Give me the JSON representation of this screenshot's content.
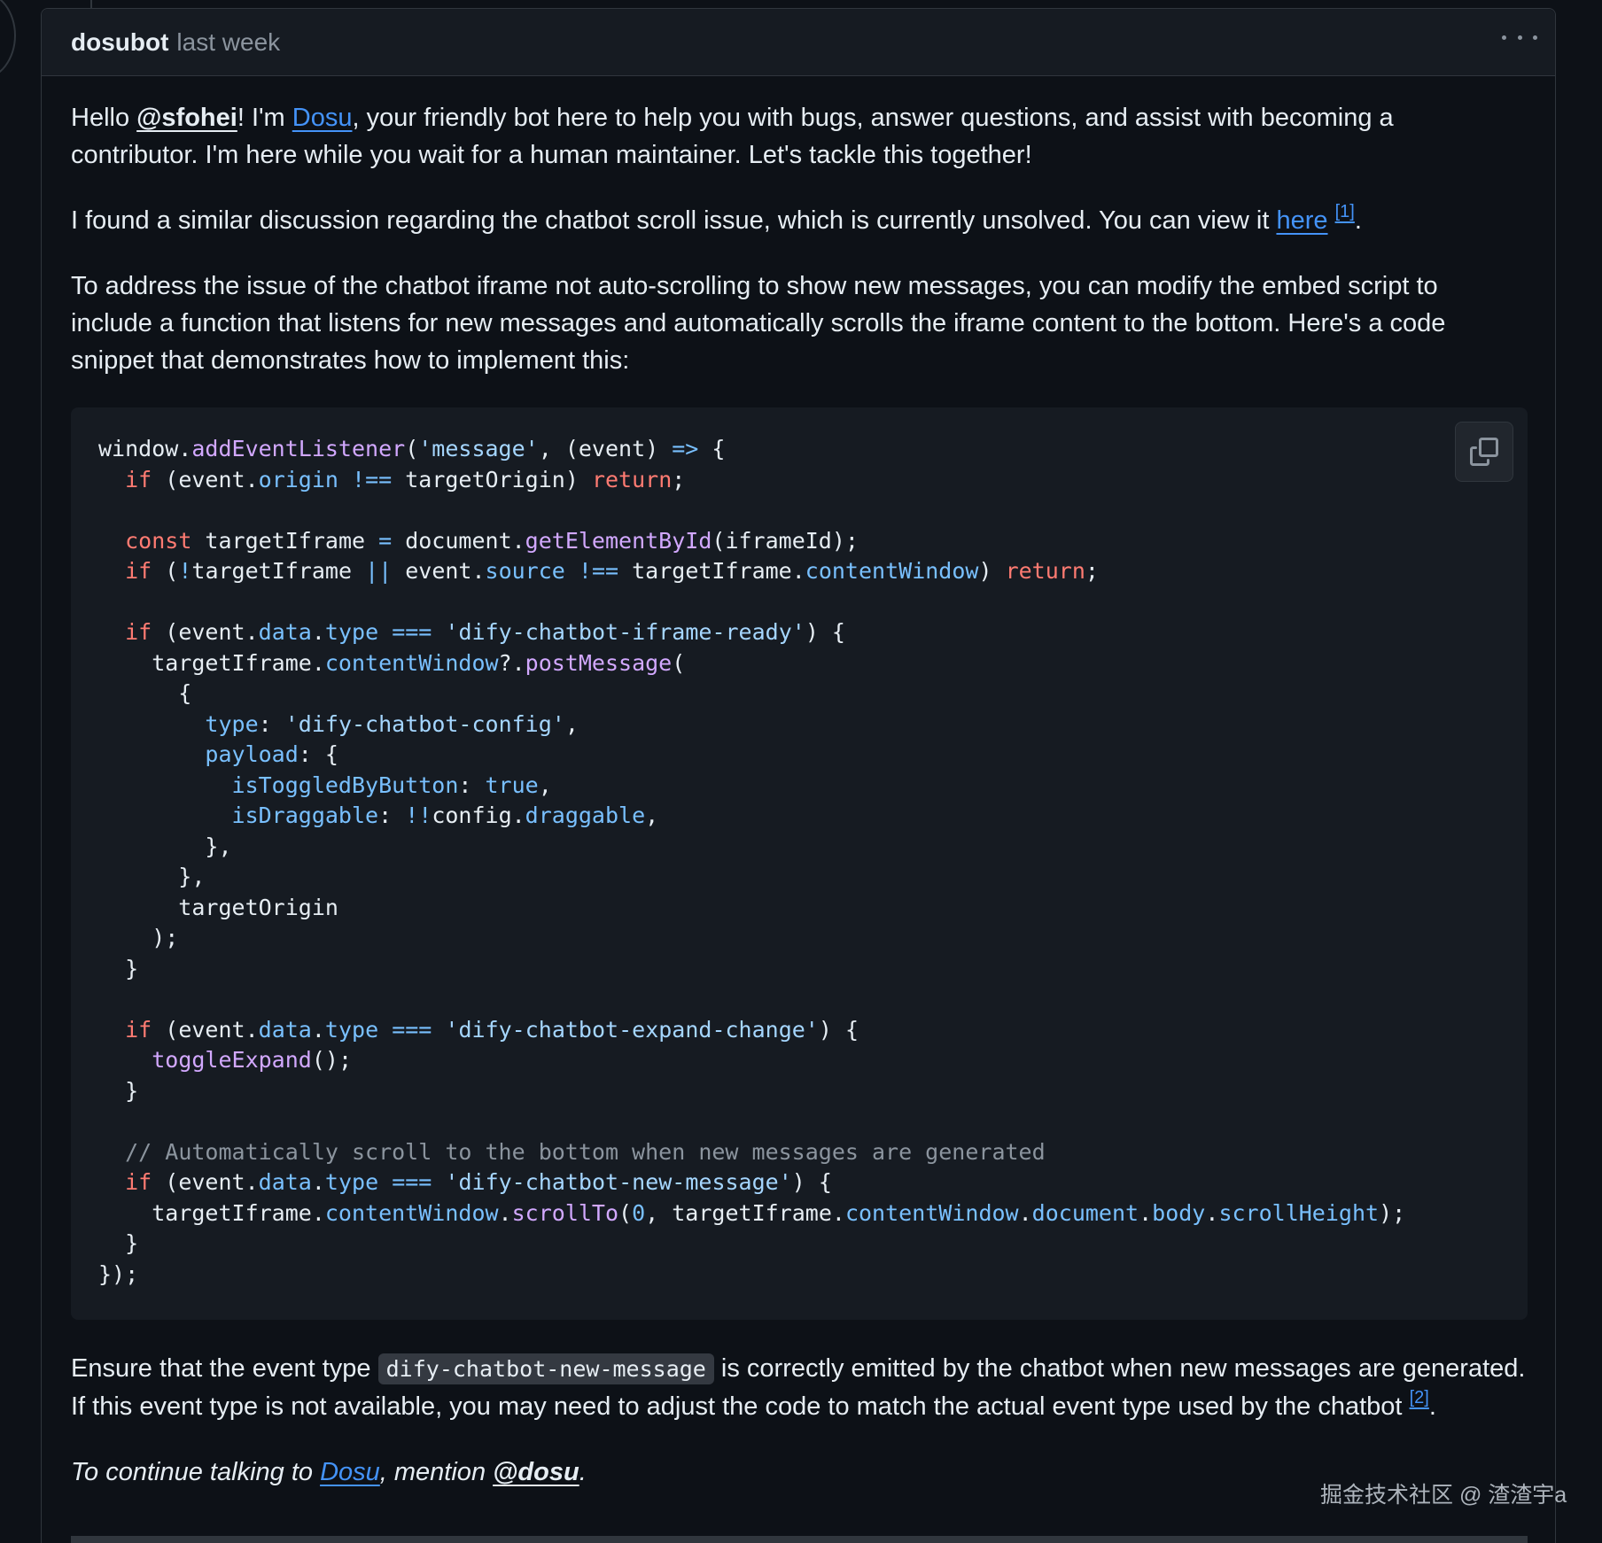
{
  "comment": {
    "author": "dosubot",
    "timestamp": "last week",
    "paragraph1": {
      "greeting": "Hello ",
      "mention": "@sfohei",
      "after_mention": "! I'm ",
      "bot_link": "Dosu",
      "rest": ", your friendly bot here to help you with bugs, answer questions, and assist with becoming a contributor. I'm here while you wait for a human maintainer. Let's tackle this together!"
    },
    "paragraph2": {
      "text": "I found a similar discussion regarding the chatbot scroll issue, which is currently unsolved. You can view it ",
      "link": "here",
      "footnote": "[1]",
      "end": "."
    },
    "paragraph3": "To address the issue of the chatbot iframe not auto-scrolling to show new messages, you can modify the embed script to include a function that listens for new messages and automatically scrolls the iframe content to the bottom. Here's a code snippet that demonstrates how to implement this:",
    "paragraph4": {
      "before_code": "Ensure that the event type ",
      "inline_code": "dify-chatbot-new-message",
      "after_code": " is correctly emitted by the chatbot when new messages are generated. If this event type is not available, you may need to adjust the code to match the actual event type used by the chatbot ",
      "footnote": "[2]",
      "end": "."
    },
    "closing": {
      "prefix": "To continue talking to ",
      "link": "Dosu",
      "middle": ", mention ",
      "mention": "@dosu",
      "end": "."
    }
  },
  "code_lines": [
    [
      [
        "",
        "window."
      ],
      [
        "fn",
        "addEventListener"
      ],
      [
        "",
        "("
      ],
      [
        "st",
        "'message'"
      ],
      [
        "",
        ", (event) "
      ],
      [
        "op",
        "=>"
      ],
      [
        "",
        " {"
      ]
    ],
    [
      [
        "",
        "  "
      ],
      [
        "kw",
        "if"
      ],
      [
        "",
        " (event."
      ],
      [
        "pr",
        "origin"
      ],
      [
        "",
        " "
      ],
      [
        "op",
        "!=="
      ],
      [
        "",
        " targetOrigin) "
      ],
      [
        "kw",
        "return"
      ],
      [
        "",
        ";"
      ]
    ],
    [],
    [
      [
        "",
        "  "
      ],
      [
        "kw",
        "const"
      ],
      [
        "",
        " targetIframe "
      ],
      [
        "op",
        "="
      ],
      [
        "",
        " document."
      ],
      [
        "fn",
        "getElementById"
      ],
      [
        "",
        "(iframeId);"
      ]
    ],
    [
      [
        "",
        "  "
      ],
      [
        "kw",
        "if"
      ],
      [
        "",
        " ("
      ],
      [
        "op",
        "!"
      ],
      [
        "",
        "targetIframe "
      ],
      [
        "op",
        "||"
      ],
      [
        "",
        " event."
      ],
      [
        "pr",
        "source"
      ],
      [
        "",
        " "
      ],
      [
        "op",
        "!=="
      ],
      [
        "",
        " targetIframe."
      ],
      [
        "pr",
        "contentWindow"
      ],
      [
        "",
        ") "
      ],
      [
        "kw",
        "return"
      ],
      [
        "",
        ";"
      ]
    ],
    [],
    [
      [
        "",
        "  "
      ],
      [
        "kw",
        "if"
      ],
      [
        "",
        " (event."
      ],
      [
        "pr",
        "data"
      ],
      [
        "",
        "."
      ],
      [
        "pr",
        "type"
      ],
      [
        "",
        " "
      ],
      [
        "op",
        "==="
      ],
      [
        "",
        " "
      ],
      [
        "st",
        "'dify-chatbot-iframe-ready'"
      ],
      [
        "",
        ") {"
      ]
    ],
    [
      [
        "",
        "    targetIframe."
      ],
      [
        "pr",
        "contentWindow"
      ],
      [
        "",
        "?."
      ],
      [
        "fn",
        "postMessage"
      ],
      [
        "",
        "("
      ]
    ],
    [
      [
        "",
        "      {"
      ]
    ],
    [
      [
        "",
        "        "
      ],
      [
        "pr",
        "type"
      ],
      [
        "",
        ": "
      ],
      [
        "st",
        "'dify-chatbot-config'"
      ],
      [
        "",
        ","
      ]
    ],
    [
      [
        "",
        "        "
      ],
      [
        "pr",
        "payload"
      ],
      [
        "",
        ": {"
      ]
    ],
    [
      [
        "",
        "          "
      ],
      [
        "pr",
        "isToggledByButton"
      ],
      [
        "",
        ": "
      ],
      [
        "pr",
        "true"
      ],
      [
        "",
        ","
      ]
    ],
    [
      [
        "",
        "          "
      ],
      [
        "pr",
        "isDraggable"
      ],
      [
        "",
        ": "
      ],
      [
        "op",
        "!!"
      ],
      [
        "",
        "config."
      ],
      [
        "pr",
        "draggable"
      ],
      [
        "",
        ","
      ]
    ],
    [
      [
        "",
        "        },"
      ]
    ],
    [
      [
        "",
        "      },"
      ]
    ],
    [
      [
        "",
        "      targetOrigin"
      ]
    ],
    [
      [
        "",
        "    );"
      ]
    ],
    [
      [
        "",
        "  }"
      ]
    ],
    [],
    [
      [
        "",
        "  "
      ],
      [
        "kw",
        "if"
      ],
      [
        "",
        " (event."
      ],
      [
        "pr",
        "data"
      ],
      [
        "",
        "."
      ],
      [
        "pr",
        "type"
      ],
      [
        "",
        " "
      ],
      [
        "op",
        "==="
      ],
      [
        "",
        " "
      ],
      [
        "st",
        "'dify-chatbot-expand-change'"
      ],
      [
        "",
        ") {"
      ]
    ],
    [
      [
        "",
        "    "
      ],
      [
        "fn",
        "toggleExpand"
      ],
      [
        "",
        "();"
      ]
    ],
    [
      [
        "",
        "  }"
      ]
    ],
    [],
    [
      [
        "",
        "  "
      ],
      [
        "cm",
        "// Automatically scroll to the bottom when new messages are generated"
      ]
    ],
    [
      [
        "",
        "  "
      ],
      [
        "kw",
        "if"
      ],
      [
        "",
        " (event."
      ],
      [
        "pr",
        "data"
      ],
      [
        "",
        "."
      ],
      [
        "pr",
        "type"
      ],
      [
        "",
        " "
      ],
      [
        "op",
        "==="
      ],
      [
        "",
        " "
      ],
      [
        "st",
        "'dify-chatbot-new-message'"
      ],
      [
        "",
        ") {"
      ]
    ],
    [
      [
        "",
        "    targetIframe."
      ],
      [
        "pr",
        "contentWindow"
      ],
      [
        "",
        "."
      ],
      [
        "fn",
        "scrollTo"
      ],
      [
        "",
        "("
      ],
      [
        "pr",
        "0"
      ],
      [
        "",
        ", targetIframe."
      ],
      [
        "pr",
        "contentWindow"
      ],
      [
        "",
        "."
      ],
      [
        "pr",
        "document"
      ],
      [
        "",
        "."
      ],
      [
        "pr",
        "body"
      ],
      [
        "",
        "."
      ],
      [
        "pr",
        "scrollHeight"
      ],
      [
        "",
        ");"
      ]
    ],
    [
      [
        "",
        "  }"
      ]
    ],
    [
      [
        "",
        "});"
      ]
    ]
  ],
  "icons": {
    "menu": "kebab-horizontal-icon",
    "copy": "copy-icon"
  },
  "watermark": "掘金技术社区 @ 渣渣宇a",
  "colors": {
    "background": "#0d1117",
    "header": "#161b22",
    "border": "#30363d",
    "link": "#4493f8",
    "keyword": "#ff7b72",
    "function": "#d2a8ff",
    "property": "#79c0ff",
    "string": "#a5d6ff",
    "comment": "#8b949e"
  }
}
